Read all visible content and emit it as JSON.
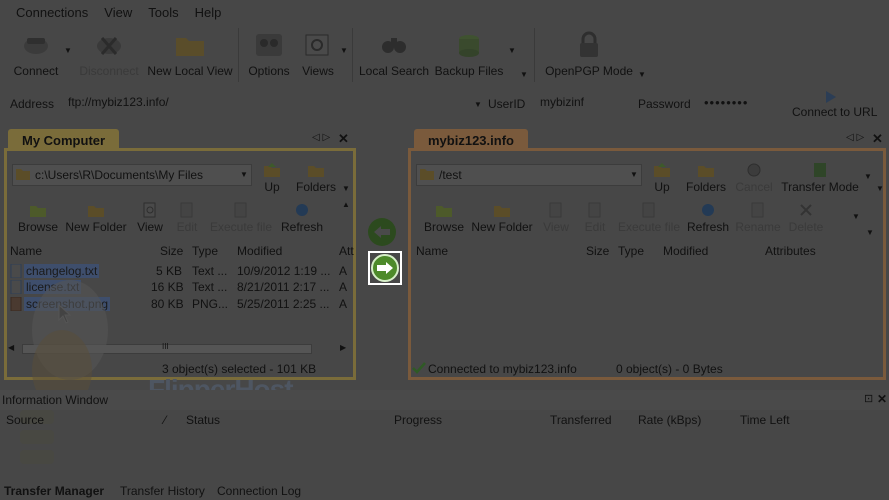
{
  "menu": {
    "connections": "Connections",
    "view": "View",
    "tools": "Tools",
    "help": "Help"
  },
  "toolbar": {
    "connect": "Connect",
    "disconnect": "Disconnect",
    "new_local_view": "New Local View",
    "options": "Options",
    "views": "Views",
    "local_search": "Local Search",
    "backup_files": "Backup Files",
    "openpgp_mode": "OpenPGP Mode"
  },
  "address_bar": {
    "address_label": "Address",
    "address_value": "ftp://mybiz123.info/",
    "userid_label": "UserID",
    "userid_value": "mybizinf",
    "password_label": "Password",
    "password_value": "••••••••",
    "connect_url": "Connect to URL"
  },
  "left_pane": {
    "tab": "My Computer",
    "path": "c:\\Users\\R\\Documents\\My Files",
    "up": "Up",
    "folders": "Folders",
    "browse": "Browse",
    "new_folder": "New Folder",
    "view": "View",
    "edit": "Edit",
    "execute_file": "Execute file",
    "refresh": "Refresh",
    "columns": {
      "name": "Name",
      "size": "Size",
      "type": "Type",
      "modified": "Modified",
      "attr": "Att"
    },
    "files": [
      {
        "name": "changelog.txt",
        "size": "5 KB",
        "type": "Text ...",
        "modified": "10/9/2012 1:19 ...",
        "attr": "A"
      },
      {
        "name": "license.txt",
        "size": "16 KB",
        "type": "Text ...",
        "modified": "8/21/2011 2:17 ...",
        "attr": "A"
      },
      {
        "name": "screenshot.png",
        "size": "80 KB",
        "type": "PNG...",
        "modified": "5/25/2011 2:25 ...",
        "attr": "A"
      }
    ],
    "scroll_marker": "III",
    "status": "3 object(s) selected - 101 KB"
  },
  "right_pane": {
    "tab": "mybiz123.info",
    "path": "/test",
    "up": "Up",
    "folders": "Folders",
    "cancel": "Cancel",
    "transfer_mode": "Transfer Mode",
    "browse": "Browse",
    "new_folder": "New Folder",
    "view": "View",
    "edit": "Edit",
    "execute_file": "Execute file",
    "refresh": "Refresh",
    "rename": "Rename",
    "delete": "Delete",
    "columns": {
      "name": "Name",
      "size": "Size",
      "type": "Type",
      "modified": "Modified",
      "attributes": "Attributes"
    },
    "status_connected": "Connected to mybiz123.info",
    "status_objects": "0 object(s) - 0 Bytes"
  },
  "info_window": {
    "title": "Information Window",
    "columns": {
      "source": "Source",
      "status": "Status",
      "progress": "Progress",
      "transferred": "Transferred",
      "rate": "Rate (kBps)",
      "time_left": "Time Left"
    }
  },
  "bottom_tabs": {
    "transfer_manager": "Transfer Manager",
    "transfer_history": "Transfer History",
    "connection_log": "Connection Log"
  },
  "watermark": "FlipperHost",
  "colors": {
    "background_dim": "#474747",
    "left_accent": "#7a6c3a",
    "right_accent": "#7a5a3c",
    "selection": "#3e4e6c",
    "arrow_green": "#4d8a2a",
    "arrow_highlight_box": "#ffffff"
  }
}
